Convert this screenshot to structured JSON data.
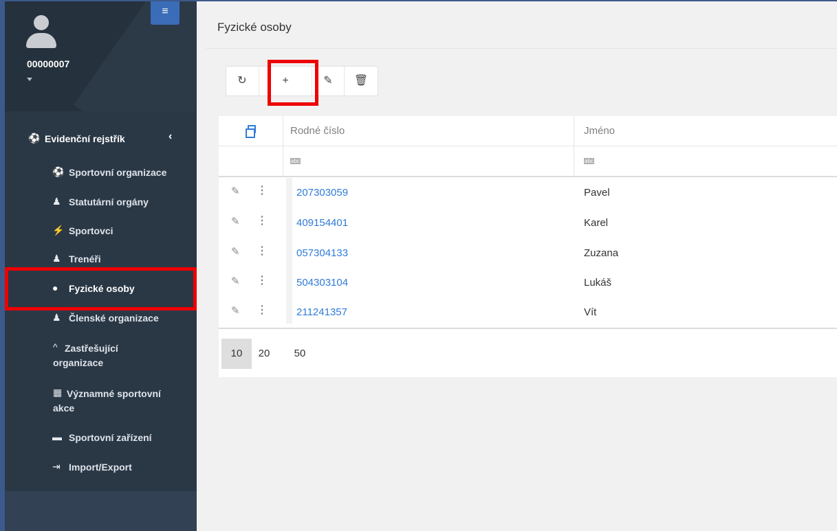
{
  "sidebar": {
    "user_id": "00000007",
    "section": {
      "label": "Evidenční rejstřík",
      "icon": "registry-icon"
    },
    "items": [
      {
        "label": "Sportovní organizace",
        "icon": "sports-org-icon"
      },
      {
        "label": "Statutární orgány",
        "icon": "statutory-body-icon"
      },
      {
        "label": "Sportovci",
        "icon": "athlete-icon"
      },
      {
        "label": "Trenéři",
        "icon": "coach-icon"
      },
      {
        "label": "Fyzické osoby",
        "icon": "user-circle-icon",
        "active": true
      },
      {
        "label": "Členské organizace",
        "icon": "member-org-icon"
      },
      {
        "label": "Zastřešující organizace",
        "icon": "chevron-up-icon"
      },
      {
        "label": "Významné sportovní akce",
        "icon": "calendar-icon"
      },
      {
        "label": "Sportovní zařízení",
        "icon": "facility-icon"
      },
      {
        "label": "Import/Export",
        "icon": "import-export-icon"
      }
    ]
  },
  "main": {
    "title": "Fyzické osoby",
    "toolbar": {
      "refresh": "↻",
      "add": "+",
      "edit": "✎",
      "delete": "🗑"
    },
    "grid": {
      "columns": [
        "Rodné číslo",
        "Jméno"
      ],
      "filter_label": "abc",
      "rows": [
        {
          "id": "207303059",
          "name": "Pavel"
        },
        {
          "id": "409154401",
          "name": "Karel"
        },
        {
          "id": "057304133",
          "name": "Zuzana"
        },
        {
          "id": "504303104",
          "name": "Lukáš"
        },
        {
          "id": "211241357",
          "name": "Vít"
        }
      ],
      "page_sizes": [
        "10",
        "20",
        "50"
      ],
      "selected_page_size": "10"
    }
  },
  "colors": {
    "sidebar_bg": "#2a3846",
    "accent_blue": "#2f7bd8",
    "highlight_red": "#ee0000"
  }
}
